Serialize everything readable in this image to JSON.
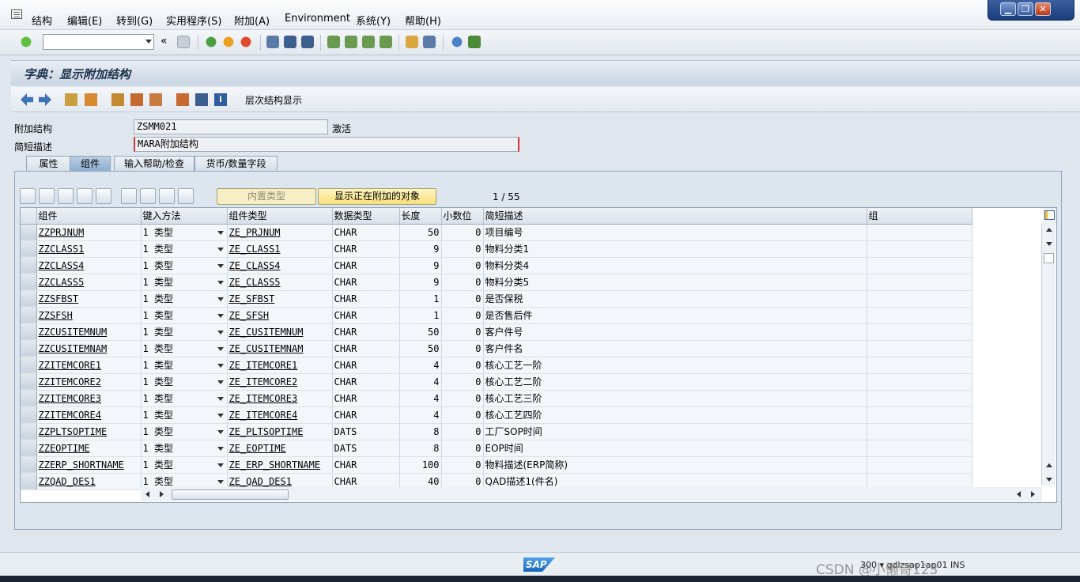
{
  "menu": [
    "结构",
    "编辑(E)",
    "转到(G)",
    "实用程序(S)",
    "附加(A)",
    "Environment",
    "系统(Y)",
    "帮助(H)"
  ],
  "window_controls": {
    "minimize": "▁",
    "restore": "❐",
    "close": "✕"
  },
  "screen_title": "字典：显示附加结构",
  "app_toolbar": {
    "hierarchy_button": "层次结构显示"
  },
  "header": {
    "append_structure_label": "附加结构",
    "append_structure_value": "ZSMM021",
    "status": "激活",
    "short_desc_label": "简短描述",
    "short_desc_value": "MARA附加结构"
  },
  "tabs": [
    {
      "label": "属性",
      "active": false
    },
    {
      "label": "组件",
      "active": true
    },
    {
      "label": "输入帮助/检查",
      "active": false
    },
    {
      "label": "货币/数量字段",
      "active": false
    }
  ],
  "table_toolbar": {
    "builtin_type_button": "内置类型",
    "show_append_button": "显示正在附加的对象",
    "pager": "1  /  55"
  },
  "columns": [
    "组件",
    "键入方法",
    "组件类型",
    "数据类型",
    "长度",
    "小数位",
    "简短描述",
    "组"
  ],
  "rows": [
    {
      "component": "ZZPRJNUM",
      "method": "1 类型",
      "comp_type": "ZE_PRJNUM",
      "data_type": "CHAR",
      "length": "50",
      "decimals": "0",
      "desc": "项目编号"
    },
    {
      "component": "ZZCLASS1",
      "method": "1 类型",
      "comp_type": "ZE_CLASS1",
      "data_type": "CHAR",
      "length": "9",
      "decimals": "0",
      "desc": "物料分类1"
    },
    {
      "component": "ZZCLASS4",
      "method": "1 类型",
      "comp_type": "ZE_CLASS4",
      "data_type": "CHAR",
      "length": "9",
      "decimals": "0",
      "desc": "物料分类4"
    },
    {
      "component": "ZZCLASS5",
      "method": "1 类型",
      "comp_type": "ZE_CLASS5",
      "data_type": "CHAR",
      "length": "9",
      "decimals": "0",
      "desc": "物料分类5"
    },
    {
      "component": "ZZSFBST",
      "method": "1 类型",
      "comp_type": "ZE_SFBST",
      "data_type": "CHAR",
      "length": "1",
      "decimals": "0",
      "desc": "是否保税"
    },
    {
      "component": "ZZSFSH",
      "method": "1 类型",
      "comp_type": "ZE_SFSH",
      "data_type": "CHAR",
      "length": "1",
      "decimals": "0",
      "desc": "是否售后件"
    },
    {
      "component": "ZZCUSITEMNUM",
      "method": "1 类型",
      "comp_type": "ZE_CUSITEMNUM",
      "data_type": "CHAR",
      "length": "50",
      "decimals": "0",
      "desc": "客户件号"
    },
    {
      "component": "ZZCUSITEMNAM",
      "method": "1 类型",
      "comp_type": "ZE_CUSITEMNAM",
      "data_type": "CHAR",
      "length": "50",
      "decimals": "0",
      "desc": "客户件名"
    },
    {
      "component": "ZZITEMCORE1",
      "method": "1 类型",
      "comp_type": "ZE_ITEMCORE1",
      "data_type": "CHAR",
      "length": "4",
      "decimals": "0",
      "desc": "核心工艺一阶"
    },
    {
      "component": "ZZITEMCORE2",
      "method": "1 类型",
      "comp_type": "ZE_ITEMCORE2",
      "data_type": "CHAR",
      "length": "4",
      "decimals": "0",
      "desc": "核心工艺二阶"
    },
    {
      "component": "ZZITEMCORE3",
      "method": "1 类型",
      "comp_type": "ZE_ITEMCORE3",
      "data_type": "CHAR",
      "length": "4",
      "decimals": "0",
      "desc": "核心工艺三阶"
    },
    {
      "component": "ZZITEMCORE4",
      "method": "1 类型",
      "comp_type": "ZE_ITEMCORE4",
      "data_type": "CHAR",
      "length": "4",
      "decimals": "0",
      "desc": "核心工艺四阶"
    },
    {
      "component": "ZZPLTSOPTIME",
      "method": "1 类型",
      "comp_type": "ZE_PLTSOPTIME",
      "data_type": "DATS",
      "length": "8",
      "decimals": "0",
      "desc": "工厂SOP时间"
    },
    {
      "component": "ZZEOPTIME",
      "method": "1 类型",
      "comp_type": "ZE_EOPTIME",
      "data_type": "DATS",
      "length": "8",
      "decimals": "0",
      "desc": "EOP时间"
    },
    {
      "component": "ZZERP_SHORTNAME",
      "method": "1 类型",
      "comp_type": "ZE_ERP_SHORTNAME",
      "data_type": "CHAR",
      "length": "100",
      "decimals": "0",
      "desc": "物料描述(ERP简称)"
    },
    {
      "component": "ZZQAD_DES1",
      "method": "1 类型",
      "comp_type": "ZE_QAD_DES1",
      "data_type": "CHAR",
      "length": "40",
      "decimals": "0",
      "desc": "QAD描述1(件名)"
    }
  ],
  "statusbar": {
    "logo": "SAP",
    "system_info": "300 ▾  gdlzsap1ap01  INS"
  },
  "watermark": "CSDN @小懒哥123"
}
